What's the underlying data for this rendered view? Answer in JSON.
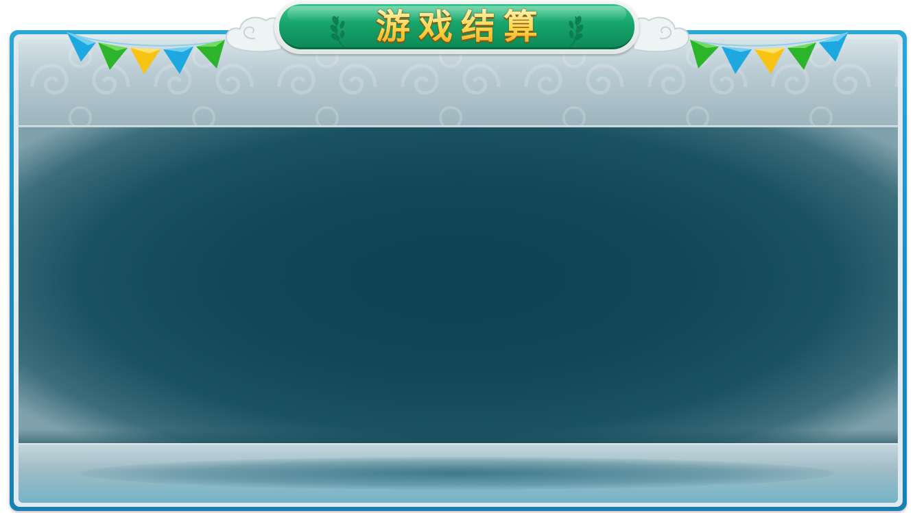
{
  "title": {
    "text": "游戏结算"
  },
  "decor": {
    "left_flags": [
      "blue-flag",
      "green-flag",
      "yellow-flag",
      "blue-flag",
      "green-flag"
    ],
    "right_flags": [
      "green-flag",
      "blue-flag",
      "yellow-flag",
      "green-flag",
      "blue-flag"
    ],
    "colors": {
      "frame": "#1d8cc0",
      "plaque": "#18a56b",
      "title_gold": "#ffd54a",
      "content": "#0e4356",
      "flag_blue": "#1ea8e0",
      "flag_green": "#2cb52a",
      "flag_yellow": "#f7c413"
    }
  }
}
